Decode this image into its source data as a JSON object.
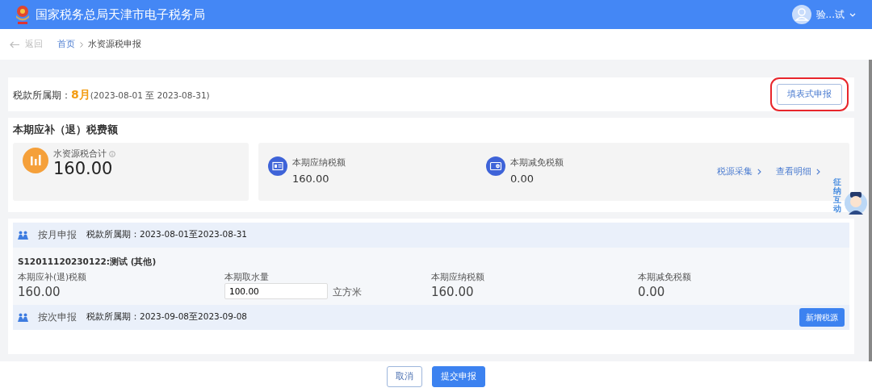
{
  "header": {
    "title": "国家税务总局天津市电子税务局",
    "user_name": "验...试"
  },
  "breadcrumb": {
    "back": "返回",
    "items": [
      {
        "label": "首页",
        "kind": "link"
      },
      {
        "label": "水资源税申报",
        "kind": "current"
      }
    ]
  },
  "period": {
    "label": "税款所属期：",
    "month": "8月",
    "range": "(2023-08-01 至 2023-08-31)",
    "button": {
      "label": "填表式申报",
      "highlighted": true
    }
  },
  "summary": {
    "title": "本期应补（退）税费额",
    "total": {
      "label": "水资源税合计",
      "value": "160.00"
    },
    "items": [
      {
        "label": "本期应纳税额",
        "value": "160.00",
        "kind": "payable"
      },
      {
        "label": "本期减免税额",
        "value": "0.00",
        "kind": "relief"
      }
    ],
    "links": [
      "税源采集",
      "查看明细"
    ]
  },
  "declarations": [
    {
      "title": "按月申报",
      "period_label": "税款所属期：",
      "period": "2023-08-01至2023-08-31",
      "sources": [
        {
          "heading": "S12011120230122:测试 (其他)",
          "fields": [
            {
              "kind": "text",
              "label": "本期应补(退)税额",
              "value": "160.00"
            },
            {
              "kind": "input",
              "label": "本期取水量",
              "value": "100.00",
              "unit": "立方米"
            },
            {
              "kind": "text",
              "label": "本期应纳税额",
              "value": "160.00"
            },
            {
              "kind": "text",
              "label": "本期减免税额",
              "value": "0.00"
            }
          ]
        }
      ]
    },
    {
      "title": "按次申报",
      "period_label": "税款所属期：",
      "period": "2023-09-08至2023-09-08",
      "button": "新增税源"
    }
  ],
  "footer": {
    "buttons": [
      {
        "label": "取消",
        "kind": "outline"
      },
      {
        "label": "提交申报",
        "kind": "primary"
      }
    ]
  },
  "helper": {
    "text": "征纳互动"
  }
}
